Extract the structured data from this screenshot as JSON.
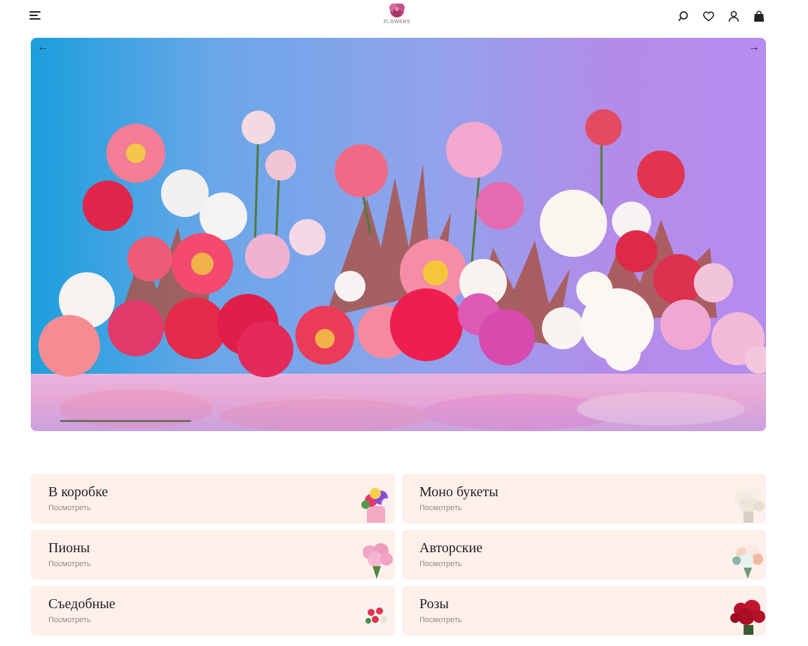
{
  "header": {
    "logo_text": "FLOWERS",
    "icons": [
      "menu-icon",
      "search-icon",
      "heart-icon",
      "user-icon",
      "bag-icon"
    ]
  },
  "hero": {
    "prev_arrow": "←",
    "next_arrow": "→",
    "progress": 0.18
  },
  "categories": [
    {
      "title": "В коробке",
      "link": "Посмотреть"
    },
    {
      "title": "Моно букеты",
      "link": "Посмотреть"
    },
    {
      "title": "Пионы",
      "link": "Посмотреть"
    },
    {
      "title": "Авторские",
      "link": "Посмотреть"
    },
    {
      "title": "Съедобные",
      "link": "Посмотреть"
    },
    {
      "title": "Розы",
      "link": "Посмотреть"
    }
  ],
  "colors": {
    "card_bg": "#fff0ec",
    "accent": "#c23a6a"
  }
}
